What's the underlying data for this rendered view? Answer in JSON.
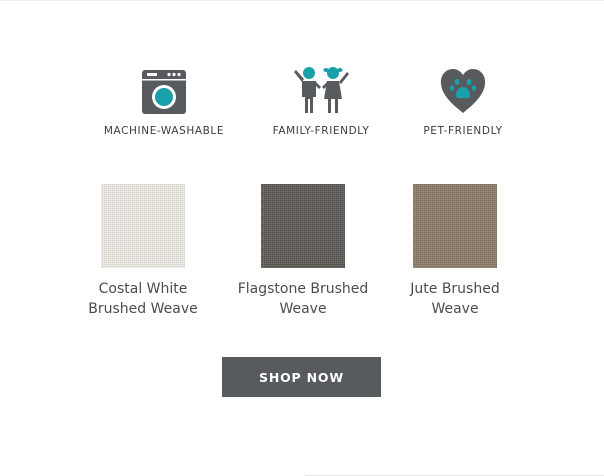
{
  "colors": {
    "icon_gray": "#575b5e",
    "accent_teal": "#1aa0a8",
    "button_bg": "#575b5e",
    "button_text": "#ffffff"
  },
  "features": [
    {
      "icon": "washing-machine-icon",
      "label": "MACHINE-WASHABLE"
    },
    {
      "icon": "family-icon",
      "label": "FAMILY-FRIENDLY"
    },
    {
      "icon": "paw-heart-icon",
      "label": "PET-FRIENDLY"
    }
  ],
  "swatches": [
    {
      "line1": "Costal White",
      "line2": "Brushed Weave",
      "color": "#f2efe8"
    },
    {
      "line1": "Flagstone Brushed",
      "line2": "Weave",
      "color": "#5a5753"
    },
    {
      "line1": "Jute Brushed",
      "line2": "Weave",
      "color": "#8c7a66"
    }
  ],
  "cta": {
    "label": "SHOP NOW"
  }
}
